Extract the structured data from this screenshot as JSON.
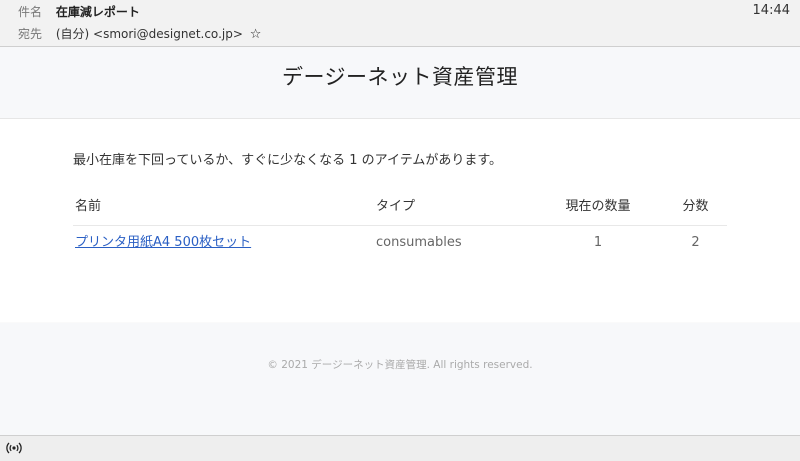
{
  "header": {
    "subject_label": "件名",
    "subject": "在庫減レポート",
    "to_label": "宛先",
    "to": "(自分) <smori@designet.co.jp>",
    "time": "14:44"
  },
  "email": {
    "banner_title": "デージーネット資産管理",
    "intro": "最小在庫を下回っているか、すぐに少なくなる 1 のアイテムがあります。",
    "table": {
      "columns": {
        "name": "名前",
        "type": "タイプ",
        "current_qty": "現在の数量",
        "min_qty": "分数"
      },
      "rows": [
        {
          "name": "プリンタ用紙A4 500枚セット",
          "type": "consumables",
          "current_qty": "1",
          "min_qty": "2"
        }
      ]
    },
    "footer": "© 2021 デージーネット資産管理. All rights reserved."
  },
  "icons": {
    "star": "star-outline-icon",
    "status": "antenna-icon"
  }
}
